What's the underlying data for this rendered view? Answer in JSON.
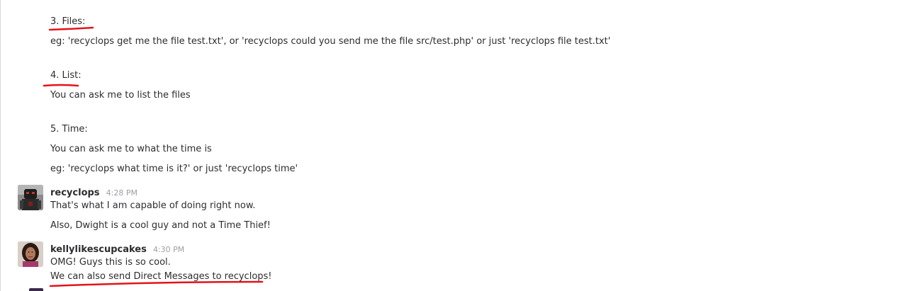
{
  "messages": {
    "help_lines": {
      "files_heading": "3. Files:",
      "files_example": "eg: 'recyclops get me the file test.txt', or 'recyclops could you send me the file src/test.php' or just 'recyclops file test.txt'",
      "list_heading": "4. List:",
      "list_desc": "You can ask me to list the files",
      "time_heading": "5. Time:",
      "time_desc": "You can ask me to what the time is",
      "time_example": "eg: 'recyclops what time is it?' or just 'recyclops time'"
    },
    "recyclops_post": {
      "username": "recyclops",
      "timestamp": "4:28 PM",
      "line1": "That's what I am capable of doing right now.",
      "line2": "Also, Dwight is a cool guy and not a Time Thief!"
    },
    "kelly_post": {
      "username": "kellylikescupcakes",
      "timestamp": "4:30 PM",
      "line1": "OMG! Guys this is so cool.",
      "line2": "We can also send Direct Messages to recyclops!"
    }
  },
  "colors": {
    "annotation": "#e3141a",
    "text": "#2c2d30",
    "timestamp": "#9e9ea6"
  },
  "icons": {
    "recyclops_avatar": "robot-avatar-icon",
    "kelly_avatar": "user-photo-avatar-icon"
  }
}
